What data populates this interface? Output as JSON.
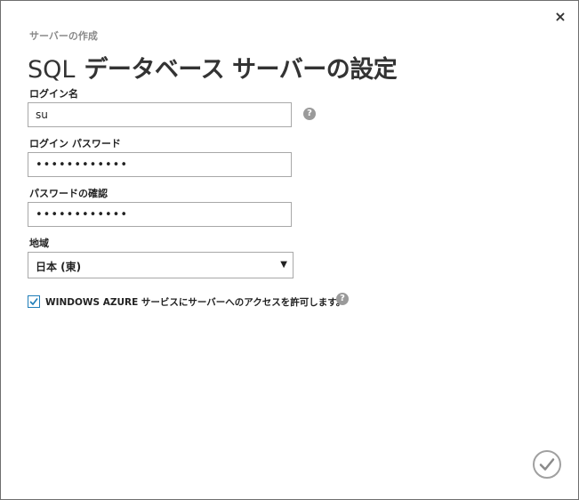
{
  "dialog": {
    "subtitle": "サーバーの作成",
    "title_prefix": "SQL",
    "title_main": "データベース サーバーの設定",
    "close_icon": "close-icon",
    "close_glyph": "×"
  },
  "form": {
    "login_name": {
      "label": "ログイン名",
      "value": "su",
      "help_glyph": "?"
    },
    "login_password": {
      "label": "ログイン パスワード",
      "value": "••••••••••••"
    },
    "confirm_password": {
      "label": "パスワードの確認",
      "value": "••••••••••••"
    },
    "region": {
      "label": "地域",
      "selected": "日本 (東)",
      "arrow_glyph": "▼"
    },
    "allow_azure": {
      "checked": true,
      "label": "WINDOWS AZURE サービスにサーバーへのアクセスを許可します。",
      "help_glyph": "?"
    }
  },
  "footer": {
    "confirm_icon": "checkmark-circle-icon"
  },
  "colors": {
    "accent": "#1f7db8",
    "border": "#a8a8a8",
    "help_icon": "#9a9a9a",
    "subtitle": "#8a8a8a"
  }
}
